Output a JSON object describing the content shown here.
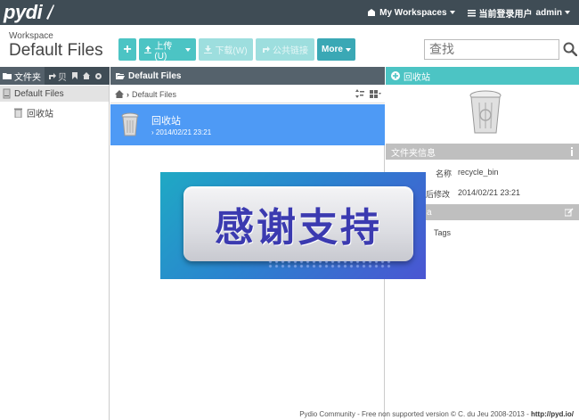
{
  "app": {
    "logo": "pydi",
    "workspaces_label": "My Workspaces",
    "user_label": "当前登录用户",
    "username": "admin"
  },
  "header": {
    "workspace_label": "Workspace",
    "title": "Default Files"
  },
  "toolbar": {
    "add_label": "+",
    "upload_label": "上传(U)",
    "download_label": "下载(W)",
    "share_label": "公共链接",
    "more_label": "More"
  },
  "search": {
    "placeholder": "查找"
  },
  "left": {
    "tab_label": "文件夹",
    "mini_tab_label": "贝",
    "tree": [
      {
        "label": "Default Files"
      },
      {
        "label": "回收站"
      }
    ]
  },
  "center": {
    "head_label": "Default Files",
    "breadcrumb": "Default Files",
    "files": [
      {
        "name": "回收站",
        "date": "2014/02/21 23:21"
      }
    ]
  },
  "right": {
    "head_label": "回收站",
    "info_head": "文件夹信息",
    "name_key": "名称",
    "name_value": "recycle_bin",
    "modified_key": "后修改",
    "modified_value": "2014/02/21 23:21",
    "meta_head": "a",
    "tags_label": "Tags"
  },
  "banner": {
    "text": "感谢支持"
  },
  "footer": {
    "text": "Pydio Community - Free non supported version © C. du Jeu 2008-2013 - ",
    "link": "http://pyd.io/"
  },
  "colors": {
    "topbar": "#3f4c55",
    "accent": "#4cc4c4",
    "selection": "#4e9af5"
  }
}
